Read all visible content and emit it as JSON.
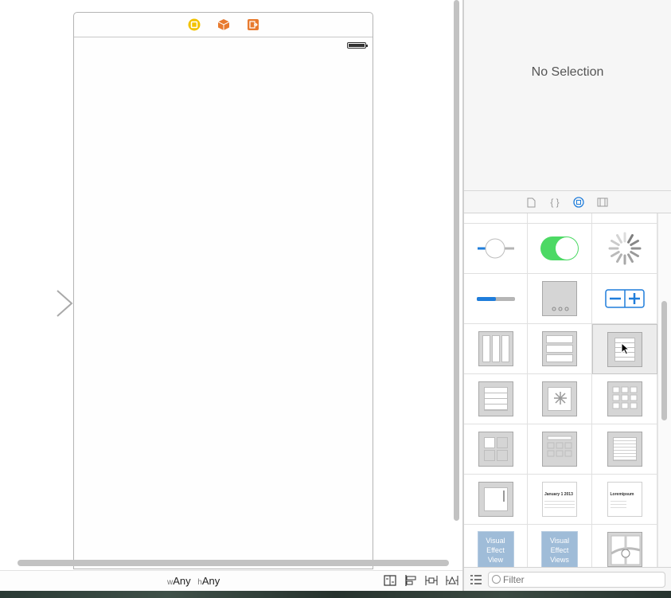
{
  "inspector": {
    "empty_text": "No Selection"
  },
  "canvas": {
    "size_class": {
      "w_prefix": "w",
      "w_value": "Any",
      "h_prefix": "h",
      "h_value": "Any"
    },
    "scene_dock_icons": [
      "view-controller-icon",
      "first-responder-icon",
      "exit-icon"
    ],
    "bottom_icons": [
      "stack-icon",
      "align-icon",
      "pin-icon",
      "resolve-issues-icon"
    ]
  },
  "library": {
    "tabs": [
      "file-template-icon",
      "code-snippet-icon",
      "object-library-icon",
      "media-library-icon"
    ],
    "active_tab": "object-library-icon",
    "items": [
      "slider",
      "switch",
      "activity-indicator",
      "progress-view",
      "page-control",
      "stepper",
      "table-view",
      "table-view-cell",
      "table-view-controller",
      "collection-view",
      "image-view",
      "collection-view-controller",
      "container-view",
      "collection-view-cell",
      "text-view",
      "scroll-view",
      "date-picker",
      "picker-view",
      "visual-effect-view",
      "visual-effect-views",
      "map-kit-view"
    ],
    "visual_effect_labels": {
      "line1": "Visual",
      "line2": "Effect",
      "line3a": "View",
      "line3b": "Views"
    },
    "date_picker": {
      "month": "January",
      "day": "1",
      "year": "2013"
    },
    "picker_title": "Loremipsum"
  },
  "filter": {
    "placeholder": "Filter"
  },
  "colors": {
    "accent": "#1f7ddb",
    "switch_on": "#4cd964",
    "scene_yellow": "#f2c200",
    "scene_orange": "#e87a2e"
  }
}
